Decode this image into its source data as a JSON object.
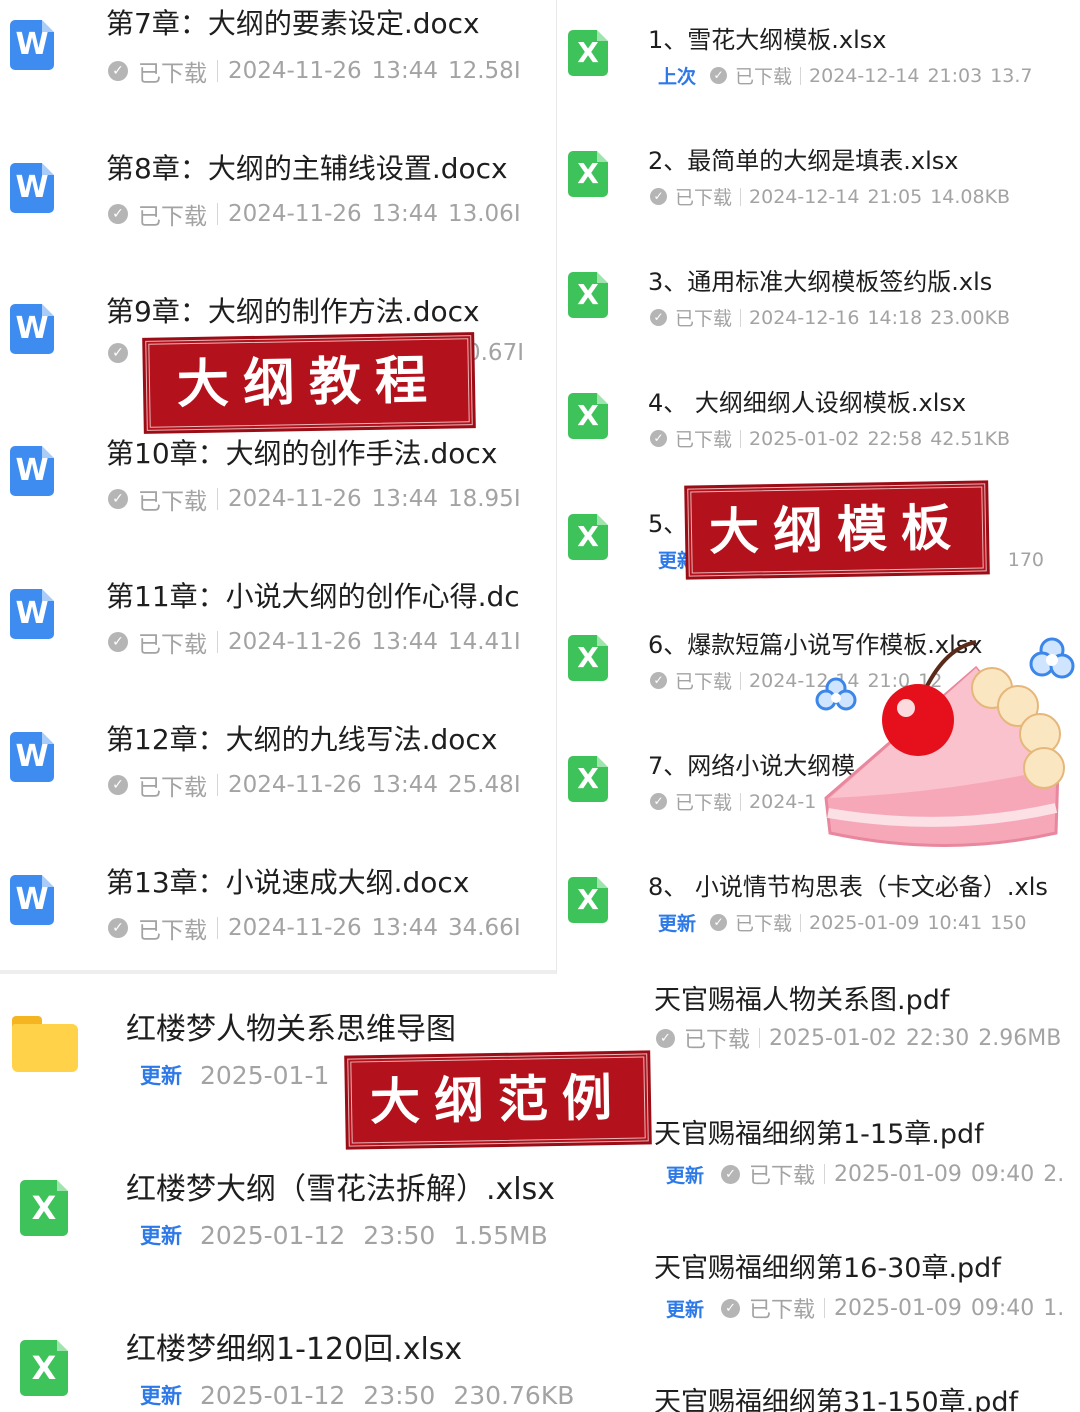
{
  "left_top": {
    "items": [
      {
        "icon": "W",
        "title": "第7章：大纲的要素设定.docx",
        "status": "已下载",
        "date": "2024-11-26",
        "time": "13:44",
        "size": "12.58I"
      },
      {
        "icon": "W",
        "title": "第8章：大纲的主辅线设置.docx",
        "status": "已下载",
        "date": "2024-11-26",
        "time": "13:44",
        "size": "13.06I"
      },
      {
        "icon": "W",
        "title": "第9章：大纲的制作方法.docx",
        "status": "",
        "date": "",
        "time": "",
        "size": "20.67I"
      },
      {
        "icon": "W",
        "title": "第10章：大纲的创作手法.docx",
        "status": "已下载",
        "date": "2024-11-26",
        "time": "13:44",
        "size": "18.95I"
      },
      {
        "icon": "W",
        "title": "第11章：小说大纲的创作心得.dc",
        "status": "已下载",
        "date": "2024-11-26",
        "time": "13:44",
        "size": "14.41I"
      },
      {
        "icon": "W",
        "title": "第12章：大纲的九线写法.docx",
        "status": "已下载",
        "date": "2024-11-26",
        "time": "13:44",
        "size": "25.48I"
      },
      {
        "icon": "W",
        "title": "第13章：小说速成大纲.docx",
        "status": "已下载",
        "date": "2024-11-26",
        "time": "13:44",
        "size": "34.66I"
      }
    ]
  },
  "right": {
    "items": [
      {
        "icon": "X",
        "title": "1、雪花大纲模板.xlsx",
        "badge": "上次",
        "status": "已下载",
        "date": "2024-12-14",
        "time": "21:03",
        "size": "13.7"
      },
      {
        "icon": "X",
        "title": "2、最简单的大纲是填表.xlsx",
        "badge": "",
        "status": "已下载",
        "date": "2024-12-14",
        "time": "21:05",
        "size": "14.08KB"
      },
      {
        "icon": "X",
        "title": "3、通用标准大纲模板签约版.xls",
        "badge": "",
        "status": "已下载",
        "date": "2024-12-16",
        "time": "14:18",
        "size": "23.00KB"
      },
      {
        "icon": "X",
        "title": "4、 大纲细纲人设纲模板.xlsx",
        "badge": "",
        "status": "已下载",
        "date": "2025-01-02",
        "time": "22:58",
        "size": "42.51KB"
      },
      {
        "icon": "X",
        "title": "5、",
        "badge": "更新",
        "status": "",
        "date": "",
        "time": "0",
        "size": "170"
      },
      {
        "icon": "X",
        "title": "6、爆款短篇小说写作模板.xlsx",
        "badge": "",
        "status": "已下载",
        "date": "2024-12-14",
        "time": "21:0",
        "size": "12"
      },
      {
        "icon": "X",
        "title": "7、网络小说大纲模",
        "badge": "",
        "status": "已下载",
        "date": "2024-1",
        "time": "",
        "size": ""
      },
      {
        "icon": "X",
        "title": "8、 小说情节构思表（卡文必备）.xls",
        "badge": "更新",
        "status": "已下载",
        "date": "2025-01-09",
        "time": "10:41",
        "size": "150"
      }
    ]
  },
  "left_bottom": {
    "items": [
      {
        "icon": "folder",
        "title": "红楼梦人物关系思维导图",
        "badge": "更新",
        "date": "2025-01-1",
        "time": "",
        "size": ""
      },
      {
        "icon": "X",
        "title": "红楼梦大纲（雪花法拆解）.xlsx",
        "badge": "更新",
        "date": "2025-01-12",
        "time": "23:50",
        "size": "1.55MB"
      },
      {
        "icon": "X",
        "title": "红楼梦细纲1-120回.xlsx",
        "badge": "更新",
        "date": "2025-01-12",
        "time": "23:50",
        "size": "230.76KB"
      }
    ]
  },
  "right_bottom": {
    "items": [
      {
        "title": "天官赐福人物关系图.pdf",
        "badge": "",
        "status": "已下载",
        "date": "2025-01-02",
        "time": "22:30",
        "size": "2.96MB"
      },
      {
        "title": "天官赐福细纲第1-15章.pdf",
        "badge": "更新",
        "status": "已下载",
        "date": "2025-01-09",
        "time": "09:40",
        "size": "2."
      },
      {
        "title": "天官赐福细纲第16-30章.pdf",
        "badge": "更新",
        "status": "已下载",
        "date": "2025-01-09",
        "time": "09:40",
        "size": "1."
      },
      {
        "title": "天官赐福细纲第31-150章.pdf",
        "badge": "",
        "status": "",
        "date": "",
        "time": "",
        "size": ""
      }
    ]
  },
  "stamps": {
    "tutorial": "大纲教程",
    "template": "大纲模板",
    "example": "大纲范例"
  },
  "colors": {
    "stamp_red": "#b3111c",
    "word_blue": "#3f8cf0",
    "excel_green": "#3ec25a",
    "badge_blue": "#2d79e8",
    "folder_yellow": "#ffd24a"
  },
  "icons": [
    "word-file-icon",
    "excel-file-icon",
    "folder-icon",
    "downloaded-check-icon",
    "cake-sticker",
    "flower-sticker"
  ]
}
